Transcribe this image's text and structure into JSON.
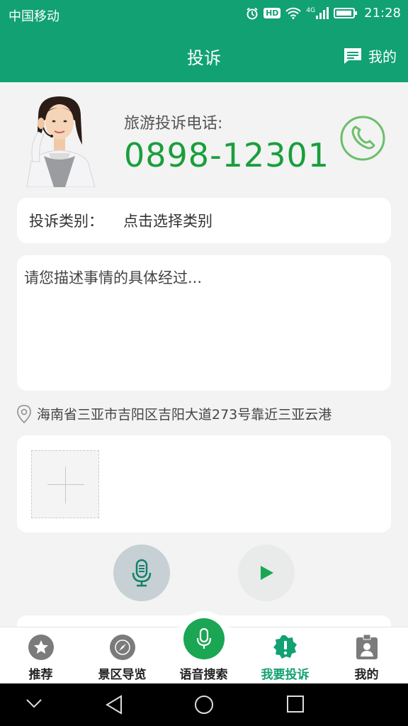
{
  "status_bar": {
    "carrier": "中国移动",
    "hd": "HD",
    "network": "4G",
    "time": "21:28"
  },
  "header": {
    "title": "投诉",
    "mine_label": "我的"
  },
  "hotline": {
    "label": "旅游投诉电话:",
    "number": "0898-12301"
  },
  "category": {
    "label": "投诉类别：",
    "value": "点击选择类别"
  },
  "description": {
    "placeholder": "请您描述事情的具体经过..."
  },
  "location": {
    "address": "海南省三亚市吉阳区吉阳大道273号靠近三亚云港"
  },
  "tabs": [
    {
      "label": "推荐",
      "icon": "star-icon"
    },
    {
      "label": "景区导览",
      "icon": "compass-icon"
    },
    {
      "label": "语音搜索",
      "icon": "microphone-icon"
    },
    {
      "label": "我要投诉",
      "icon": "alert-badge-icon",
      "active": true
    },
    {
      "label": "我的",
      "icon": "profile-badge-icon"
    }
  ],
  "colors": {
    "brand_green": "#12a172",
    "number_green": "#1a9e3d",
    "voice_green": "#1aa653"
  }
}
